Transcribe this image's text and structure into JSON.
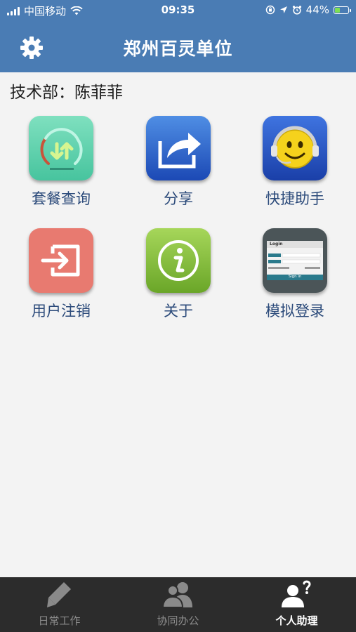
{
  "status_bar": {
    "carrier": "中国移动",
    "time": "09:35",
    "battery": "44%",
    "battery_level": 0.44
  },
  "header": {
    "title": "郑州百灵单位",
    "settings_icon": "gear-icon"
  },
  "user": {
    "line": "技术部：陈菲菲"
  },
  "grid": {
    "items": [
      {
        "label": "套餐查询",
        "icon": "data-transfer-icon"
      },
      {
        "label": "分享",
        "icon": "share-icon"
      },
      {
        "label": "快捷助手",
        "icon": "smiley-headset-icon"
      },
      {
        "label": "用户注销",
        "icon": "logout-icon"
      },
      {
        "label": "关于",
        "icon": "info-icon"
      },
      {
        "label": "模拟登录",
        "icon": "login-screen-icon"
      }
    ]
  },
  "tabbar": {
    "tabs": [
      {
        "label": "日常工作",
        "icon": "pencil-icon",
        "active": false
      },
      {
        "label": "协同办公",
        "icon": "people-icon",
        "active": false
      },
      {
        "label": "个人助理",
        "icon": "person-question-icon",
        "active": true
      }
    ]
  },
  "login_thumb": {
    "title": "Login",
    "button": "Sign in"
  }
}
